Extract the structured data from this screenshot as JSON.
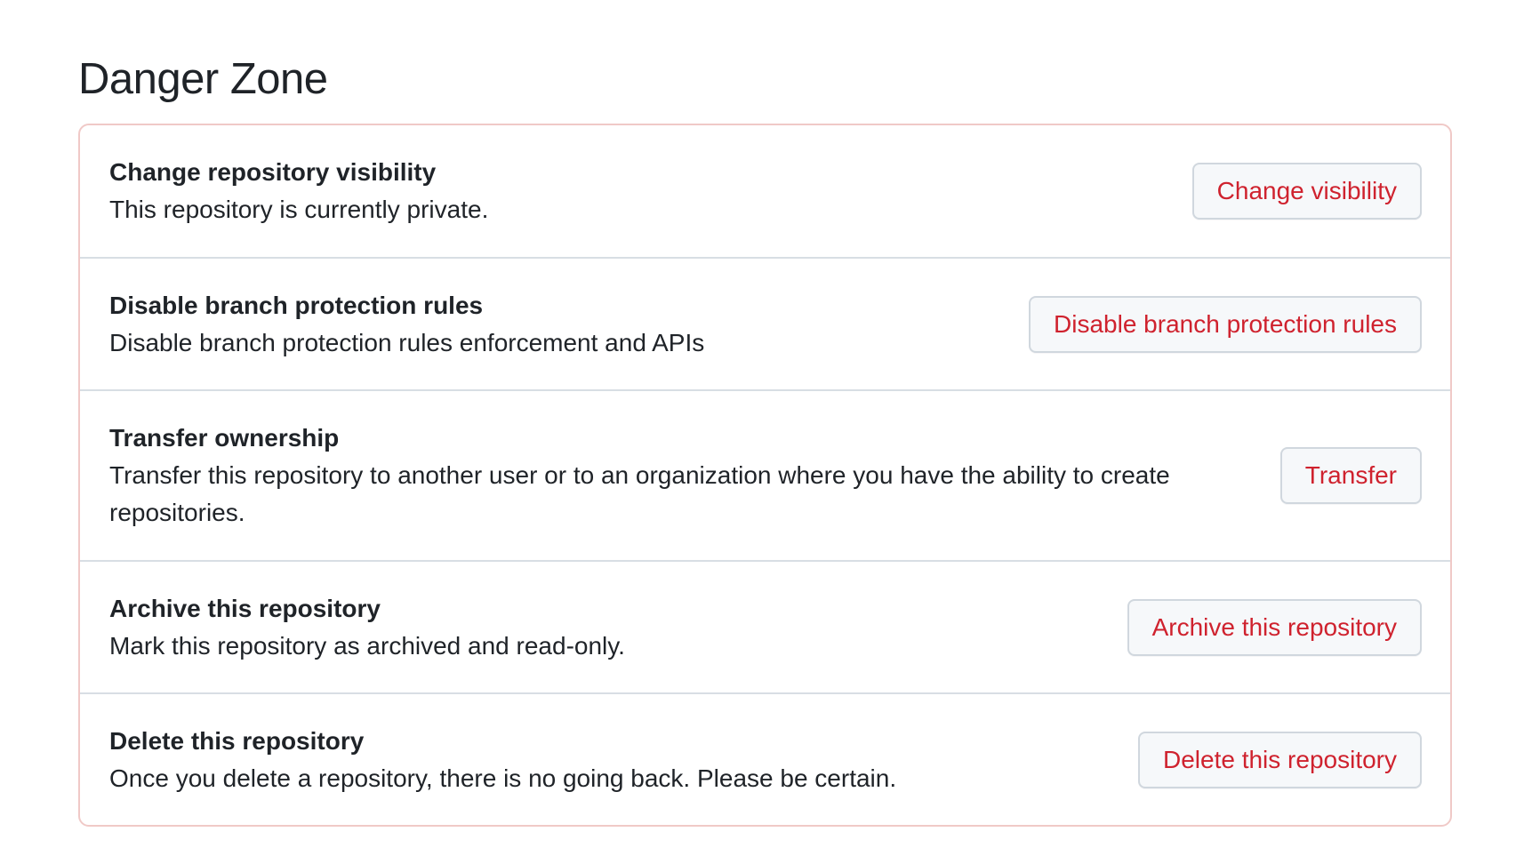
{
  "page": {
    "title": "Danger Zone"
  },
  "danger_zone": {
    "items": [
      {
        "title": "Change repository visibility",
        "description": "This repository is currently private.",
        "button_label": "Change visibility"
      },
      {
        "title": "Disable branch protection rules",
        "description": "Disable branch protection rules enforcement and APIs",
        "button_label": "Disable branch protection rules"
      },
      {
        "title": "Transfer ownership",
        "description": "Transfer this repository to another user or to an organization where you have the ability to create repositories.",
        "button_label": "Transfer"
      },
      {
        "title": "Archive this repository",
        "description": "Mark this repository as archived and read-only.",
        "button_label": "Archive this repository"
      },
      {
        "title": "Delete this repository",
        "description": "Once you delete a repository, there is no going back. Please be certain.",
        "button_label": "Delete this repository"
      }
    ]
  },
  "colors": {
    "danger_text": "#cf222e",
    "danger_border": "#f0c9c7",
    "divider": "#d8dee4",
    "button_background": "#f6f8fa",
    "text": "#1f2328"
  }
}
